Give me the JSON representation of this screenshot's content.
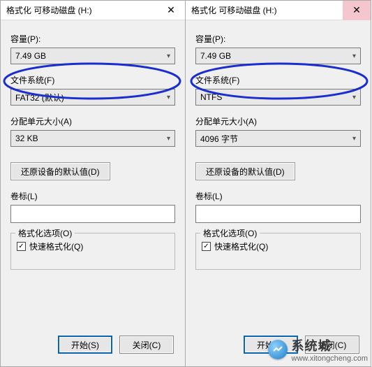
{
  "left": {
    "title": "格式化 可移动磁盘 (H:)",
    "close": "✕",
    "capacity_label": "容量(P):",
    "capacity_value": "7.49 GB",
    "fs_label": "文件系统(F)",
    "fs_value": "FAT32 (默认)",
    "alloc_label": "分配单元大小(A)",
    "alloc_value": "32 KB",
    "restore_btn": "还原设备的默认值(D)",
    "volume_label": "卷标(L)",
    "volume_value": "",
    "options_legend": "格式化选项(O)",
    "quick_format": "快速格式化(Q)",
    "start_btn": "开始(S)",
    "close_btn": "关闭(C)"
  },
  "right": {
    "title": "格式化 可移动磁盘 (H:)",
    "close": "✕",
    "capacity_label": "容量(P):",
    "capacity_value": "7.49 GB",
    "fs_label": "文件系统(F)",
    "fs_value": "NTFS",
    "alloc_label": "分配单元大小(A)",
    "alloc_value": "4096 字节",
    "restore_btn": "还原设备的默认值(D)",
    "volume_label": "卷标(L)",
    "volume_value": "",
    "options_legend": "格式化选项(O)",
    "quick_format": "快速格式化(Q)",
    "start_btn": "开始(S)",
    "close_btn": "关闭(C)"
  },
  "checkmark": "✓",
  "watermark": {
    "brand": "系统城",
    "url": "www.xitongcheng.com"
  }
}
